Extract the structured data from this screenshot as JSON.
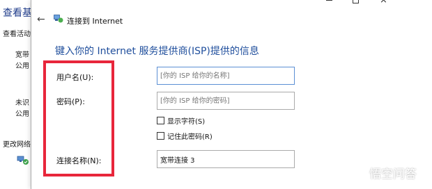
{
  "background": {
    "title": "查看基",
    "subtitle": "查看活动",
    "network1_name": "宽带",
    "network1_sub": "公用",
    "network2_name": "未识",
    "network2_sub": "公用",
    "change_settings": "更改网络"
  },
  "dialog": {
    "back_icon": "back-arrow-icon",
    "app_title": "连接到 Internet",
    "heading": "键入你的 Internet 服务提供商(ISP)提供的信息",
    "username_label": "用户名(U):",
    "username_placeholder": "[你的 ISP 给你的名称]",
    "password_label": "密码(P):",
    "password_placeholder": "[你的 ISP 给你的密码]",
    "show_chars_label": "显示字符(S)",
    "remember_label": "记住此密码(R)",
    "conn_name_label": "连接名称(N):",
    "conn_name_value": "宽带连接 3"
  },
  "annotation": {
    "color": "#e8263b"
  },
  "watermark": {
    "text": "悟空问答"
  }
}
